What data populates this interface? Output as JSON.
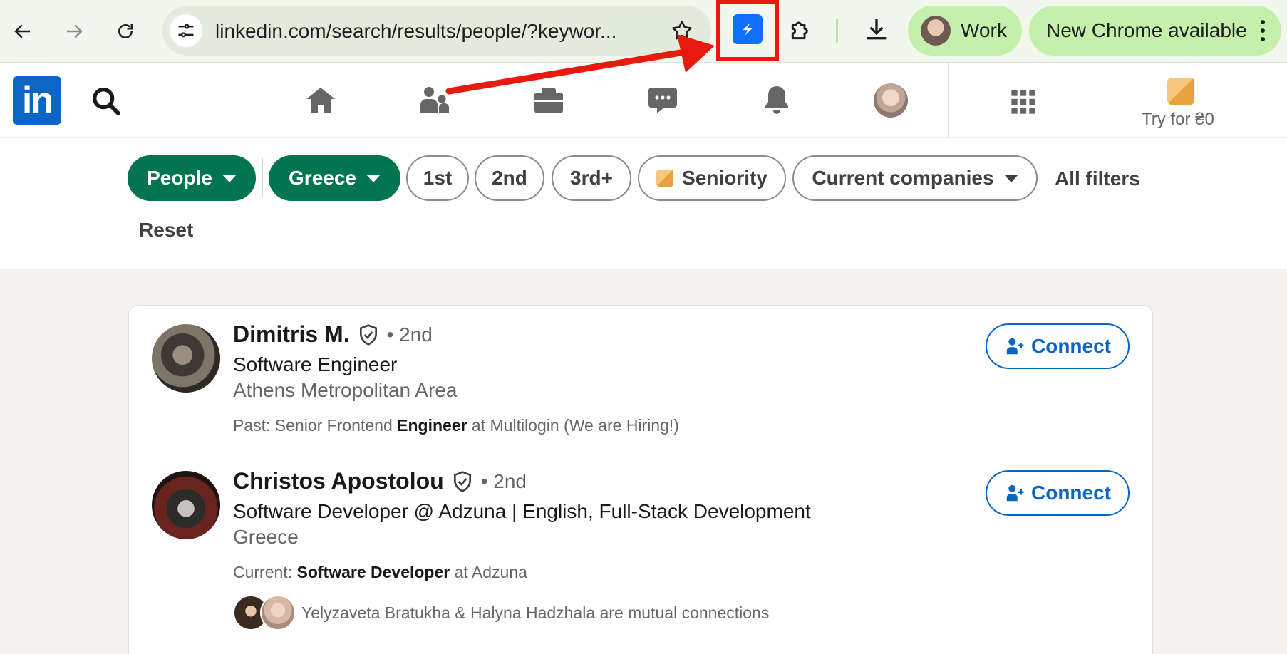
{
  "browser": {
    "url": "linkedin.com/search/results/people/?keywor...",
    "profile_label": "Work",
    "update_label": "New Chrome available",
    "colors": {
      "toolbar": "#f1f7ec",
      "chip": "#c5f0ab",
      "highlight": "#e8190f",
      "extension": "#0f6fff"
    }
  },
  "linkedin_header": {
    "logo_text": "in",
    "premium_label": "Try for ₴0",
    "brand_color": "#0a66c2"
  },
  "filters": {
    "people": "People",
    "location": "Greece",
    "first": "1st",
    "second": "2nd",
    "third_plus": "3rd+",
    "seniority": "Seniority",
    "current_companies": "Current companies",
    "all_filters": "All filters",
    "reset": "Reset",
    "active_color": "#01754f"
  },
  "results": [
    {
      "name": "Dimitris M.",
      "degree": "• 2nd",
      "headline": "Software Engineer",
      "location": "Athens Metropolitan Area",
      "snippet_prefix": "Past: Senior Frontend ",
      "snippet_bold": "Engineer",
      "snippet_suffix": " at Multilogin (We are Hiring!)",
      "action": "Connect"
    },
    {
      "name": "Christos Apostolou",
      "degree": "• 2nd",
      "headline": "Software Developer @ Adzuna | English, Full-Stack Development",
      "location": "Greece",
      "snippet_prefix": "Current: ",
      "snippet_bold": "Software Developer",
      "snippet_suffix": " at Adzuna",
      "mutual": "Yelyzaveta Bratukha & Halyna Hadzhala are mutual connections",
      "action": "Connect"
    }
  ]
}
